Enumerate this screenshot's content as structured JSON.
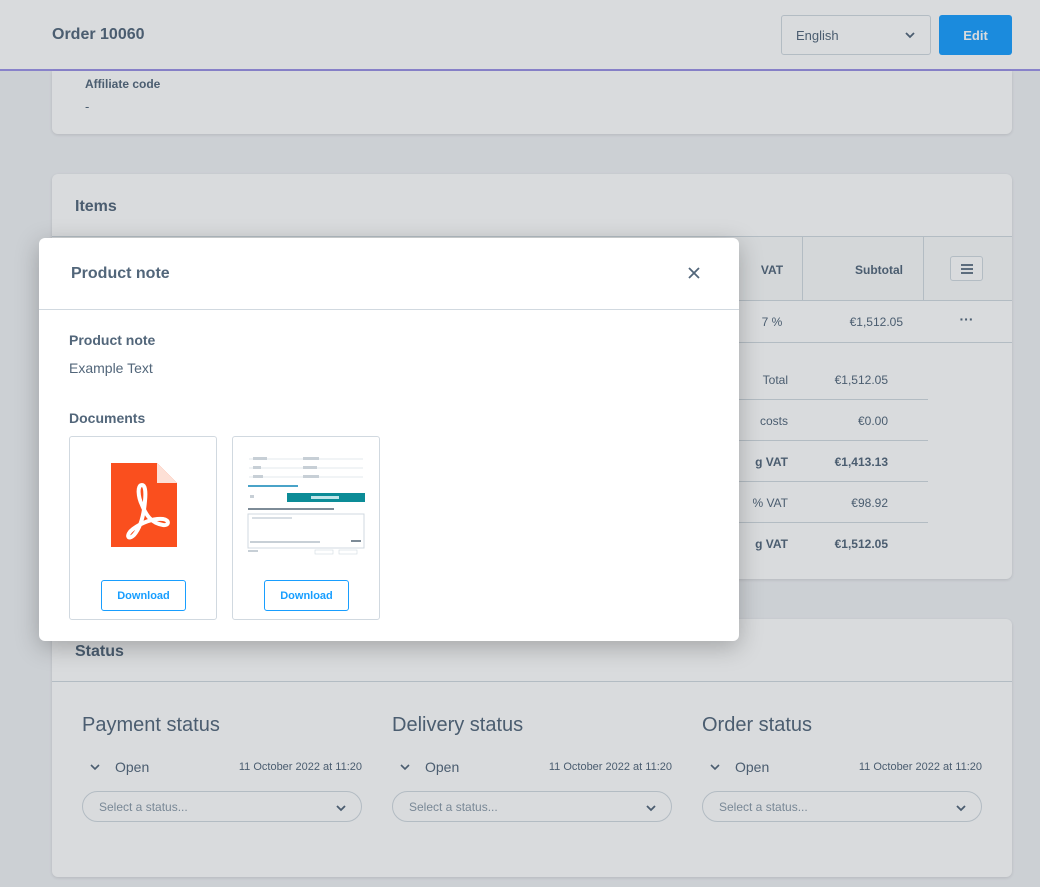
{
  "header": {
    "title": "Order 10060",
    "language": "English",
    "edit_label": "Edit"
  },
  "affiliate": {
    "label": "Affiliate code",
    "value": "-"
  },
  "items": {
    "title": "Items",
    "columns": {
      "vat": "VAT",
      "subtotal": "Subtotal"
    },
    "row": {
      "vat": "7 %",
      "subtotal": "€1,512.05",
      "actions": "···"
    },
    "summary": [
      {
        "label": "Total",
        "value": "€1,512.05",
        "bold": false
      },
      {
        "label": "costs",
        "value": "€0.00",
        "bold": false
      },
      {
        "label": "g VAT",
        "value": "€1,413.13",
        "bold": true
      },
      {
        "label": "% VAT",
        "value": "€98.92",
        "bold": false
      },
      {
        "label": "g VAT",
        "value": "€1,512.05",
        "bold": true
      }
    ]
  },
  "status": {
    "title": "Status",
    "columns": [
      {
        "heading": "Payment status",
        "state": "Open",
        "date": "11 October 2022 at 11:20",
        "placeholder": "Select a status..."
      },
      {
        "heading": "Delivery status",
        "state": "Open",
        "date": "11 October 2022 at 11:20",
        "placeholder": "Select a status..."
      },
      {
        "heading": "Order status",
        "state": "Open",
        "date": "11 October 2022 at 11:20",
        "placeholder": "Select a status..."
      }
    ]
  },
  "modal": {
    "title": "Product note",
    "note_label": "Product note",
    "note_text": "Example Text",
    "documents_label": "Documents",
    "documents": [
      {
        "type": "pdf",
        "icon": "pdf-icon",
        "button": "Download"
      },
      {
        "type": "image",
        "icon": "image-thumbnail",
        "button": "Download"
      }
    ]
  },
  "colors": {
    "accent": "#189eff",
    "header_border": "#9d93e8",
    "pdf": "#fa4f1e",
    "text": "#52667a"
  }
}
